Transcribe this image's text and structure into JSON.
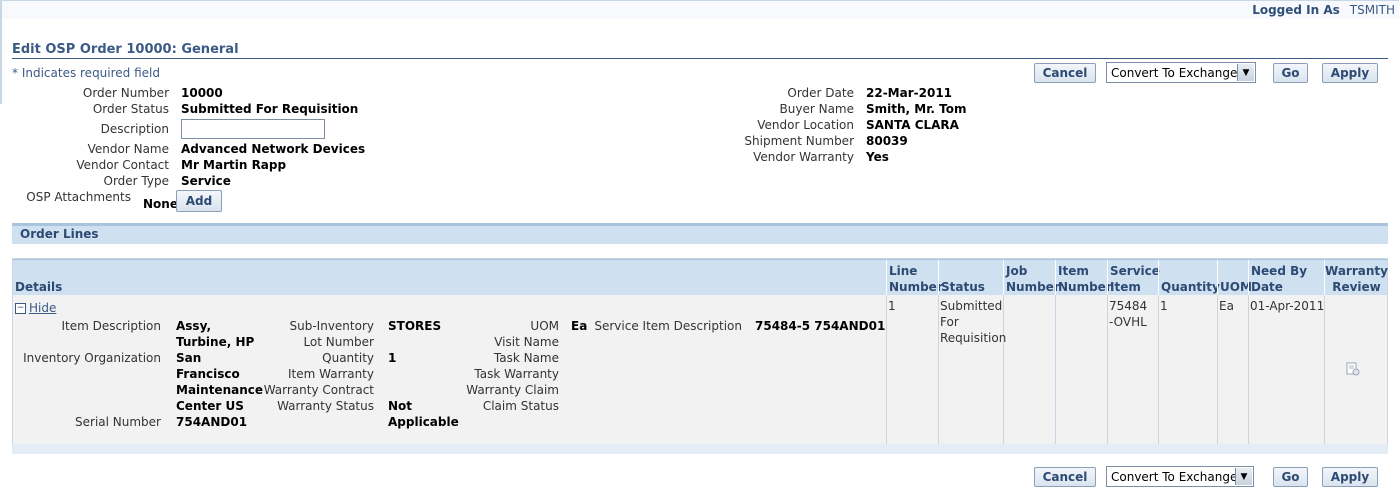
{
  "header": {
    "logged_in_label": "Logged In As",
    "user": "TSMITH"
  },
  "page": {
    "title": "Edit OSP Order 10000: General",
    "required_note": "* Indicates required field"
  },
  "actions": {
    "cancel": "Cancel",
    "convert_select": "Convert To Exchange",
    "go": "Go",
    "apply": "Apply"
  },
  "left_fields": [
    {
      "label": "Order Number",
      "value": "10000"
    },
    {
      "label": "Order Status",
      "value": "Submitted For Requisition"
    },
    {
      "label": "Description",
      "value": ""
    },
    {
      "label": "Vendor Name",
      "value": "Advanced Network Devices"
    },
    {
      "label": "Vendor Contact",
      "value": "Mr Martin Rapp"
    },
    {
      "label": "Order Type",
      "value": "Service"
    },
    {
      "label": "OSP Attachments",
      "value": "None",
      "button": "Add"
    }
  ],
  "right_fields": [
    {
      "label": "Order Date",
      "value": "22-Mar-2011"
    },
    {
      "label": "Buyer Name",
      "value": "Smith, Mr. Tom"
    },
    {
      "label": "Vendor Location",
      "value": "SANTA CLARA"
    },
    {
      "label": "Shipment Number",
      "value": "80039"
    },
    {
      "label": "Vendor Warranty",
      "value": "Yes"
    }
  ],
  "order_lines": {
    "section_title": "Order Lines",
    "columns": [
      "Details",
      "Line Number",
      "Status",
      "Job Number",
      "Item Number",
      "Service Item",
      "Quantity",
      "UOM",
      "Need By Date",
      "Warranty Review"
    ],
    "row": {
      "hide_label": "Hide",
      "line_number": "1",
      "status": "Submitted For Requisition",
      "job_number": "",
      "item_number": "",
      "service_item": "75484-OVHL",
      "quantity": "1",
      "uom": "Ea",
      "need_by_date": "01-Apr-2011",
      "warranty_icon": "warranty-review-icon",
      "details": {
        "item_description_label": "Item Description",
        "item_description": "Assy, Turbine, HP",
        "inventory_org_label": "Inventory Organization",
        "inventory_org": "San Francisco Maintenance Center US",
        "serial_number_label": "Serial Number",
        "serial_number": "754AND01",
        "sub_inventory_label": "Sub-Inventory",
        "sub_inventory": "STORES",
        "lot_number_label": "Lot Number",
        "lot_number": "",
        "quantity_label": "Quantity",
        "quantity": "1",
        "item_warranty_label": "Item Warranty",
        "item_warranty": "",
        "warranty_contract_label": "Warranty Contract",
        "warranty_contract": "",
        "warranty_status_label": "Warranty Status",
        "warranty_status": "Not Applicable",
        "uom_label": "UOM",
        "uom": "Ea",
        "visit_name_label": "Visit Name",
        "task_name_label": "Task Name",
        "task_warranty_label": "Task Warranty",
        "warranty_claim_label": "Warranty Claim",
        "claim_status_label": "Claim Status",
        "service_item_desc_label": "Service Item Description",
        "service_item_desc": "75484-5 754AND01"
      }
    }
  }
}
